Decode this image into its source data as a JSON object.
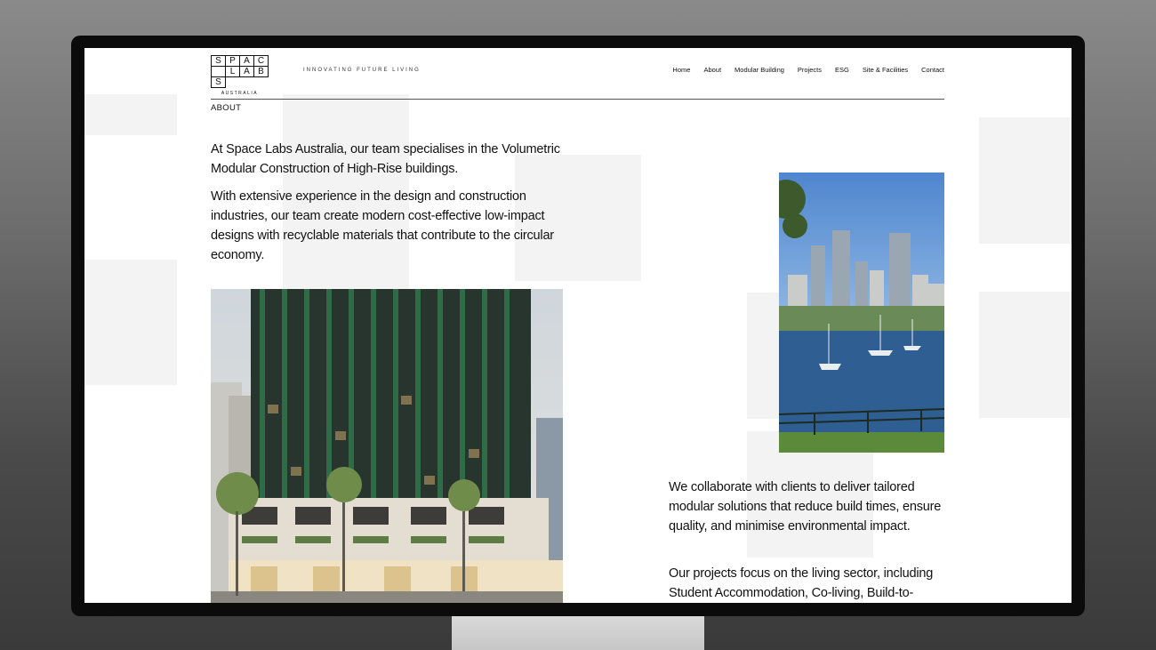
{
  "brand": {
    "logo_letters": [
      "S",
      "P",
      "A",
      "C",
      "",
      "L",
      "A",
      "B",
      "S"
    ],
    "logo_sub": "AUSTRALIA",
    "tagline": "INNOVATING FUTURE LIVING"
  },
  "nav": {
    "items": [
      {
        "label": "Home"
      },
      {
        "label": "About"
      },
      {
        "label": "Modular Building"
      },
      {
        "label": "Projects"
      },
      {
        "label": "ESG"
      },
      {
        "label": "Site & Facilities"
      },
      {
        "label": "Contact"
      }
    ]
  },
  "page": {
    "section_label": "ABOUT",
    "paragraphs": [
      "At Space Labs Australia, our team specialises in the Volumetric Modular Construction of High-Rise buildings.",
      "With extensive experience in the design and construction industries, our team create modern cost-effective low-impact designs with recyclable materials that contribute to the circular economy.",
      "We collaborate with clients to deliver tailored modular solutions that reduce build times, ensure quality, and minimise environmental impact.",
      "Our projects focus on the living sector, including Student Accommodation, Co-living, Build-to-"
    ]
  },
  "colors": {
    "page_background": "#ffffff",
    "text": "#111111",
    "tile": "#f3f3f3",
    "monitor_bezel": "#0b0b0b"
  }
}
